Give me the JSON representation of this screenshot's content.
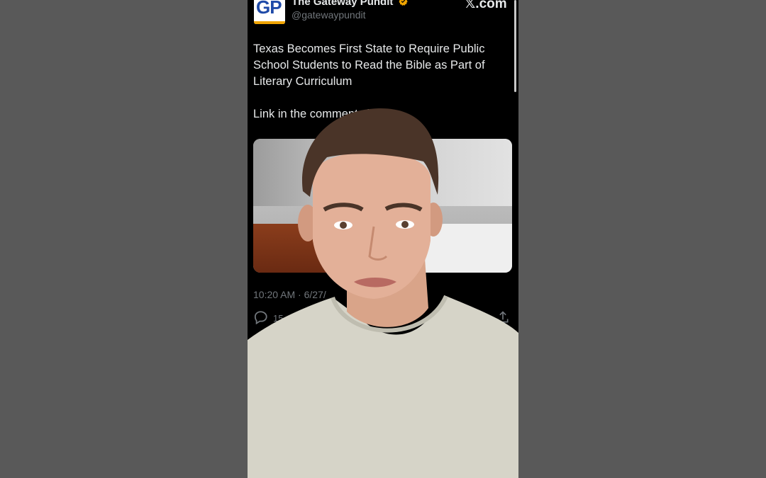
{
  "tweet": {
    "avatar_text": "GP",
    "display_name": "The Gateway Pundit",
    "handle": "@gatewaypundit",
    "site": "𝕏.com",
    "text_line1": "Texas Becomes First State to Require Public School Students to Read the Bible as Part of Literary Curriculum",
    "text_line2": "Link in the comments below.",
    "timestamp": "10:20 AM · 6/27/",
    "reply_count": "15"
  },
  "colors": {
    "background": "#595959",
    "phone": "#000000",
    "text": "#e7e9ea",
    "muted": "#71767b",
    "verified": "#f0a400",
    "gp_blue": "#1f4aa8"
  },
  "icons": [
    "verified-badge-icon",
    "reply-icon",
    "share-icon"
  ]
}
